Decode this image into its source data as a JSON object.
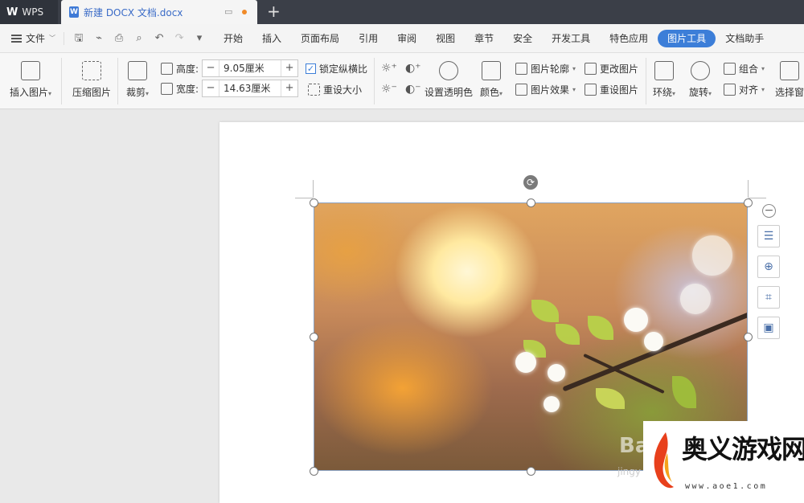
{
  "titlebar": {
    "app_tab": "WPS",
    "doc_tab": "新建 DOCX 文档.docx",
    "add_tab": "+"
  },
  "menubar": {
    "file_label": "文件",
    "items": [
      "开始",
      "插入",
      "页面布局",
      "引用",
      "审阅",
      "视图",
      "章节",
      "安全",
      "开发工具",
      "特色应用",
      "图片工具",
      "文档助手"
    ],
    "active_item": "图片工具"
  },
  "ribbon": {
    "insert_picture": "插入图片",
    "compress_picture": "压缩图片",
    "crop": "裁剪",
    "height_label": "高度:",
    "height_value": "9.05厘米",
    "width_label": "宽度:",
    "width_value": "14.63厘米",
    "lock_ratio": "锁定纵横比",
    "reset_size": "重设大小",
    "set_transparent": "设置透明色",
    "color": "颜色",
    "picture_outline": "图片轮廓",
    "picture_effect": "图片效果",
    "change_picture": "更改图片",
    "reset_picture": "重设图片",
    "wrap": "环绕",
    "rotate": "旋转",
    "group": "组合",
    "align": "对齐",
    "selection_pane": "选择窗"
  },
  "watermark": {
    "site_name": "奥义游戏网",
    "site_url": "www.aoe1.com",
    "baidu": "Bai",
    "baidu_sub": "jingy"
  },
  "colors": {
    "accent": "#3c7ed8",
    "titlebar": "#3b3f48",
    "tab_dot": "#f08a28"
  }
}
